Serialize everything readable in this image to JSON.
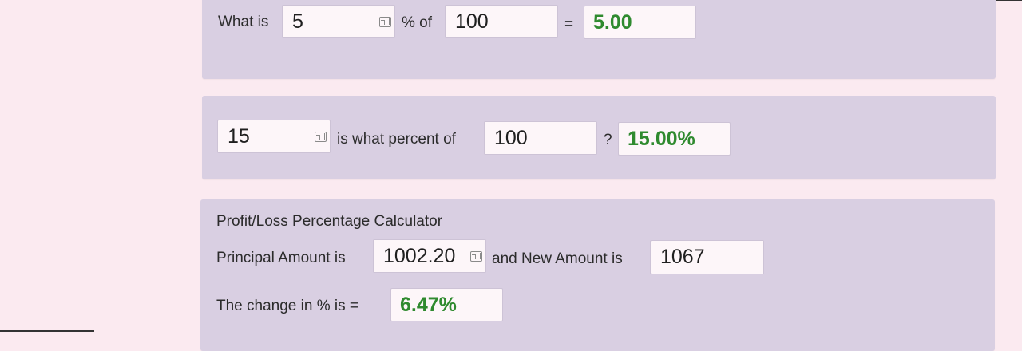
{
  "percent_of": {
    "label_what_is": "What is",
    "percent_value": "5",
    "label_percent_of": "% of",
    "base_value": "100",
    "equals": "=",
    "result": "5.00"
  },
  "what_percent": {
    "part_value": "15",
    "label_is_what_percent_of": "is what percent of",
    "whole_value": "100",
    "question": "?",
    "result": "15.00%"
  },
  "profit_loss": {
    "title": "Profit/Loss Percentage Calculator",
    "label_principal": "Principal Amount is",
    "principal_value": "1002.20",
    "label_new_amount": "and New Amount is",
    "new_amount_value": "1067",
    "label_change": "The change in % is =",
    "result": "6.47%"
  },
  "colors": {
    "page_background": "#fbeaf0",
    "panel_background": "#d9cfe2",
    "input_background": "#fdf6f9",
    "result_text": "#2f8a2f"
  },
  "icons": {
    "spinner": "number-spinner-icon"
  }
}
